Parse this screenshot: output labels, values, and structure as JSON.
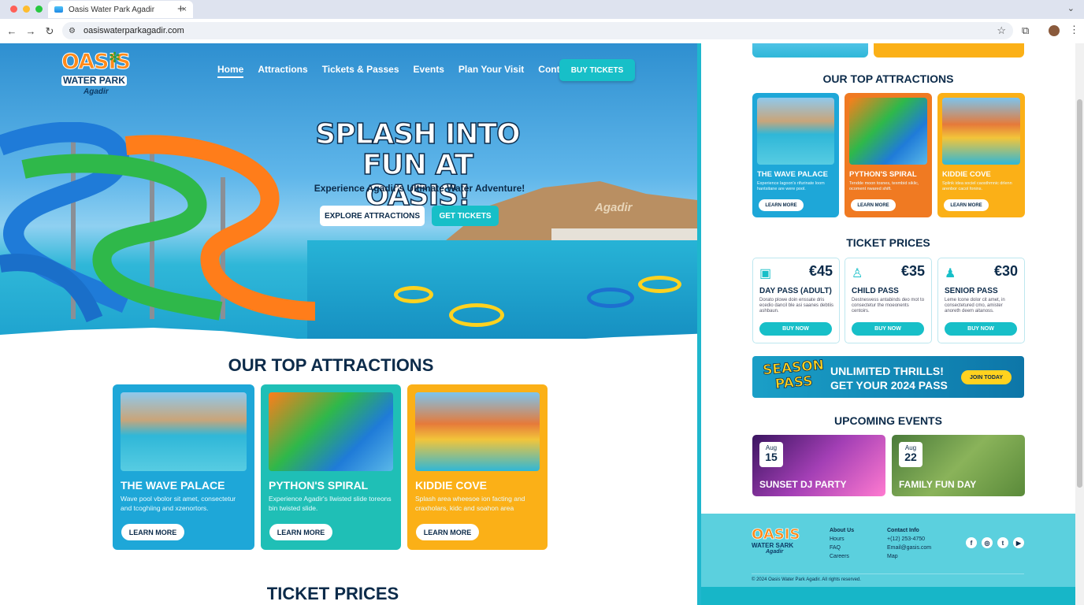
{
  "browser": {
    "tab_title": "Oasis Water Park Agadir",
    "close_glyph": "×",
    "new_tab_glyph": "+",
    "url": "oasiswaterparkagadir.com",
    "back_glyph": "←",
    "forward_glyph": "→",
    "reload_glyph": "↻",
    "star_glyph": "☆",
    "menu_glyph": "⋮"
  },
  "site": {
    "logo": {
      "name": "OASIS",
      "line2": "WATER PARK",
      "line3": "Agadir"
    },
    "nav": [
      "Home",
      "Attractions",
      "Tickets & Passes",
      "Events",
      "Plan Your Visit",
      "Contact"
    ],
    "buy_tickets": "BUY TICKETS",
    "hero": {
      "headline_1": "SPLASH INTO",
      "headline_2": "FUN AT OASIS!",
      "subtitle": "Experience Agadir's Ultimate Water Adventure!",
      "btn_explore": "EXPLORE ATTRACTIONS",
      "btn_tickets": "GET TICKETS",
      "mountain_text": "Agadir"
    },
    "attractions_title": "OUR TOP ATTRACTIONS",
    "attractions": [
      {
        "name": "THE WAVE PALACE",
        "desc": "Wave pool vbolor sit amet, consectetur and tcoghiing and xzenortors.",
        "btn": "LEARN MORE",
        "color": "#1ea7d8"
      },
      {
        "name": "PYTHON'S SPIRAL",
        "desc": "Experience Agadir's llwisted slide toreons bin twisted slide.",
        "btn": "LEARN MORE",
        "color": "#1fbfb6"
      },
      {
        "name": "KIDDIE COVE",
        "desc": "Splash area wheesoe ion facting and craxholars, kidc and soahon area",
        "btn": "LEARN MORE",
        "color": "#fbb017"
      }
    ],
    "ticket_prices_title": "TICKET PRICES"
  },
  "right_panel": {
    "attractions_title": "OUR TOP ATTRACTIONS",
    "attractions": [
      {
        "name": "THE WAVE PALACE",
        "desc": "Experience lagoon's rifurinate loom hantsitane are were pool.",
        "btn": "LEARN MORE",
        "color": "#1ea7d8"
      },
      {
        "name": "PYTHON'S SPIRAL",
        "desc": "Tendde moon tosnes, texmbid siklic, ocoment nwared shift.",
        "btn": "LEARN MORE",
        "color": "#f07a22"
      },
      {
        "name": "KIDDIE COVE",
        "desc": "Splink idea sociel caosthmnic drlenn arenbor cacol fonins.",
        "btn": "LEARN MORE",
        "color": "#fbb017"
      }
    ],
    "ticket_prices_title": "TICKET PRICES",
    "tickets": [
      {
        "price": "€45",
        "name": "DAY PASS (ADULT)",
        "desc": "Dorato plowe doin enssate dris ecedio dancil ble asi saanes debtiis ashbaun.",
        "btn": "BUY NOW",
        "icon": "group-icon"
      },
      {
        "price": "€35",
        "name": "CHILD PASS",
        "desc": "Destnesvess antabinds deo mot to consectetur the rnoeonents centoirs.",
        "btn": "BUY NOW",
        "icon": "child-icon"
      },
      {
        "price": "€30",
        "name": "SENIOR PASS",
        "desc": "Leme lcone dolor cit amet, in consectetured cmo, amister anoreth deem aitanoss.",
        "btn": "BUY NOW",
        "icon": "senior-icon"
      }
    ],
    "season": {
      "badge_1": "SEASON",
      "badge_2": "PASS",
      "line_1": "UNLIMITED THRILLS!",
      "line_2": "GET YOUR 2024 PASS",
      "btn": "JOIN TODAY"
    },
    "events_title": "UPCOMING EVENTS",
    "events": [
      {
        "month": "Aug",
        "day": "15",
        "title": "SUNSET DJ PARTY"
      },
      {
        "month": "Aug",
        "day": "22",
        "title": "FAMILY FUN DAY"
      }
    ],
    "footer": {
      "logo": {
        "name": "OASIS",
        "line2": "WATER SARK",
        "line3": "Agadir"
      },
      "col1": [
        "About Us",
        "Hours",
        "FAQ",
        "Careers"
      ],
      "col2": [
        "Contact Info",
        "+(12) 253-4750",
        "Email@gasis.com",
        "Map"
      ],
      "social": [
        "facebook-icon",
        "instagram-icon",
        "twitter-icon",
        "youtube-icon"
      ],
      "social_glyphs": [
        "f",
        "◎",
        "t",
        "▶"
      ],
      "copyright": "© 2024 Oasis Water Park Agadir. All rights reserved."
    }
  }
}
